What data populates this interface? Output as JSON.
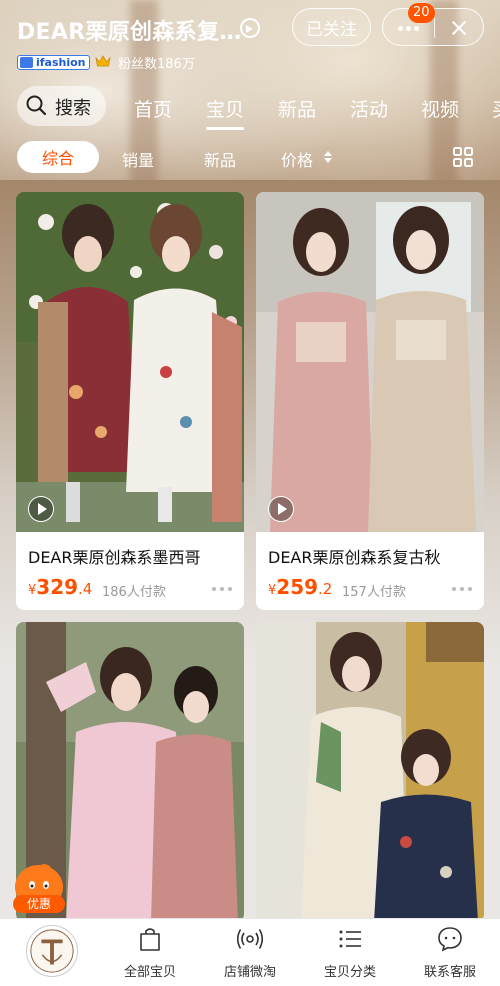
{
  "header": {
    "shop_name": "DEAR栗原创森系复…",
    "follow_label": "已关注",
    "badge_count": "20",
    "ifashion_label": "ifashion",
    "fans_text": "粉丝数186万"
  },
  "nav": {
    "search_label": "搜索",
    "tabs": [
      "首页",
      "宝贝",
      "新品",
      "活动",
      "视频",
      "买"
    ],
    "active_tab": "宝贝"
  },
  "sort": {
    "active": "综合",
    "items": [
      "销量",
      "新品",
      "价格"
    ]
  },
  "products": [
    {
      "name": "DEAR栗原创森系墨西哥",
      "price_yen": "¥",
      "price_int": "329",
      "price_dec": ".4",
      "sold": "186人付款",
      "has_video": true
    },
    {
      "name": "DEAR栗原创森系复古秋",
      "price_yen": "¥",
      "price_int": "259",
      "price_dec": ".2",
      "sold": "157人付款",
      "has_video": true
    },
    {
      "name": "",
      "has_video": false
    },
    {
      "name": "",
      "has_video": false
    }
  ],
  "promo": {
    "label": "优惠"
  },
  "bottom_bar": {
    "items": [
      {
        "label": "全部宝贝",
        "icon": "shopping-bag-icon"
      },
      {
        "label": "店铺微淘",
        "icon": "broadcast-icon"
      },
      {
        "label": "宝贝分类",
        "icon": "category-list-icon"
      },
      {
        "label": "联系客服",
        "icon": "chat-bubble-icon"
      }
    ]
  },
  "colors": {
    "accent": "#ff5000",
    "badge": "#ff5500",
    "ifashion_blue": "#3c7be6"
  }
}
